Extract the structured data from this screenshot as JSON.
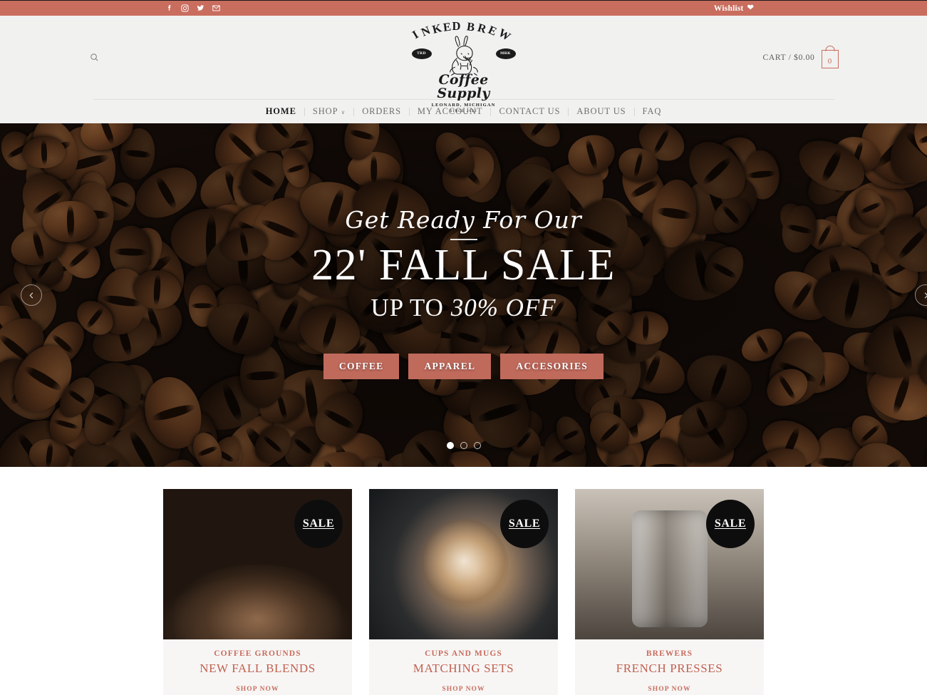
{
  "topbar": {
    "social": [
      {
        "name": "facebook-icon",
        "glyph": "f"
      },
      {
        "name": "instagram-icon",
        "glyph": "ig"
      },
      {
        "name": "twitter-icon",
        "glyph": "tw"
      },
      {
        "name": "email-icon",
        "glyph": "mail"
      }
    ],
    "wishlist_label": "Wishlist",
    "wishlist_icon": "heart-icon",
    "background": "#c96d5e"
  },
  "header": {
    "search_icon": "search-icon",
    "logo": {
      "arc_text": "INKED BREW",
      "badge_left": "TRD",
      "badge_right": "MRK",
      "script_text": "Coffee Supply",
      "location": "LEONARD, MICHIGAN",
      "since": "SINCE 2022",
      "art": "tattooed-rabbit-illustration"
    },
    "cart": {
      "label": "CART / $0.00",
      "count": "0",
      "icon": "shopping-bag-icon"
    },
    "background": "#f1f1f0"
  },
  "nav": {
    "items": [
      {
        "label": "HOME",
        "active": true,
        "caret": false
      },
      {
        "label": "SHOP",
        "active": false,
        "caret": true
      },
      {
        "label": "ORDERS",
        "active": false,
        "caret": false
      },
      {
        "label": "MY ACCOUNT",
        "active": false,
        "caret": false
      },
      {
        "label": "CONTACT US",
        "active": false,
        "caret": false
      },
      {
        "label": "ABOUT US",
        "active": false,
        "caret": false
      },
      {
        "label": "FAQ",
        "active": false,
        "caret": false
      }
    ]
  },
  "hero": {
    "background_image": "roasted-coffee-beans-photo",
    "pretitle": "Get Ready For Our",
    "title": "22' FALL SALE",
    "subtitle_prefix": "UP TO ",
    "subtitle_emphasis": "30% OFF",
    "buttons": [
      {
        "label": "COFFEE"
      },
      {
        "label": "APPAREL"
      },
      {
        "label": "ACCESORIES"
      }
    ],
    "button_color": "#c06a5c",
    "prev_icon": "chevron-left-icon",
    "next_icon": "chevron-right-icon",
    "slides": 3,
    "active_slide": 1
  },
  "cards": [
    {
      "badge": "SALE",
      "kicker": "COFFEE GROUNDS",
      "title": "NEW FALL BLENDS",
      "cta": "SHOP NOW",
      "image": "coffee-beans-in-burlap-sack",
      "image_class": "img-beans"
    },
    {
      "badge": "SALE",
      "kicker": "CUPS AND MUGS",
      "title": "MATCHING SETS",
      "cta": "SHOP NOW",
      "image": "latte-art-cappuccino-cup",
      "image_class": "img-cup"
    },
    {
      "badge": "SALE",
      "kicker": "BREWERS",
      "title": "FRENCH PRESSES",
      "cta": "SHOP NOW",
      "image": "stainless-french-press",
      "image_class": "img-press"
    }
  ],
  "colors": {
    "accent": "#c96d5e",
    "accent_dark": "#c1604f",
    "header_bg": "#f1f1f0",
    "card_bg": "#f7f6f5",
    "badge_bg": "#0d0d0d"
  }
}
